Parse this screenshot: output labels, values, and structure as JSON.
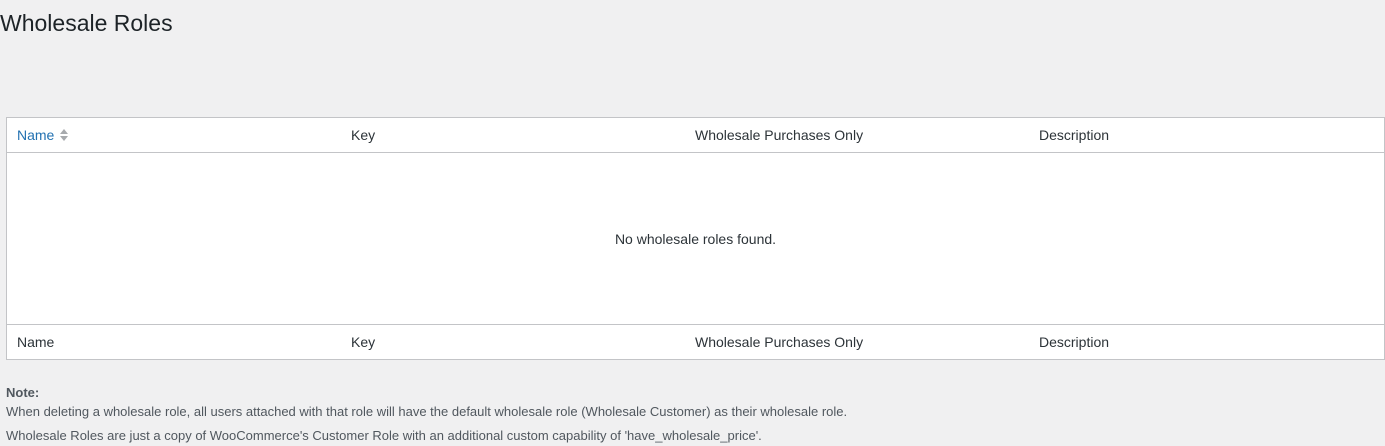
{
  "page": {
    "title": "Wholesale Roles"
  },
  "table": {
    "columns": [
      "Name",
      "Key",
      "Wholesale Purchases Only",
      "Description"
    ],
    "empty_message": "No wholesale roles found."
  },
  "notes": {
    "label": "Note:",
    "lines": [
      "When deleting a wholesale role, all users attached with that role will have the default wholesale role (Wholesale Customer) as their wholesale role.",
      "Wholesale Roles are just a copy of WooCommerce's Customer Role with an additional custom capability of 'have_wholesale_price'."
    ]
  },
  "colors": {
    "background": "#f0f0f1",
    "link": "#2271b1",
    "border": "#c3c4c7"
  }
}
